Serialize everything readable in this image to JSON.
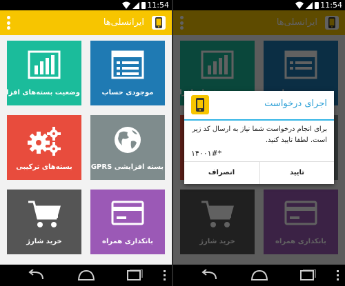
{
  "status": {
    "time": "11:54"
  },
  "app": {
    "title": "ایرانسلی‌ها"
  },
  "tiles": [
    {
      "label": "موجودی حساب",
      "color": "#1f7ab3",
      "icon": "list-icon"
    },
    {
      "label": "وضعیت بسته‌های افزایشی",
      "color": "#1bbc9b",
      "icon": "bar-chart-icon"
    },
    {
      "label": "بسته افزایشی GPRS",
      "color": "#7f8c8d",
      "icon": "globe-icon"
    },
    {
      "label": "بسته‌های ترکیبی",
      "color": "#e84c3d",
      "icon": "gears-icon"
    },
    {
      "label": "بانکداری همراه",
      "color": "#9b59b6",
      "icon": "card-icon"
    },
    {
      "label": "خرید شارژ",
      "color": "#555555",
      "icon": "cart-icon"
    }
  ],
  "dialog": {
    "title": "اجرای درخواست",
    "message": "برای انجام درخواست شما نیاز به ارسال کد زیر است. لطفا تایید کنید.",
    "code": "*۱۴۰۰۱#",
    "confirm": "تایید",
    "cancel": "انصراف"
  },
  "colors": {
    "brand": "#f7c500",
    "dialog_accent": "#33b5e5"
  }
}
